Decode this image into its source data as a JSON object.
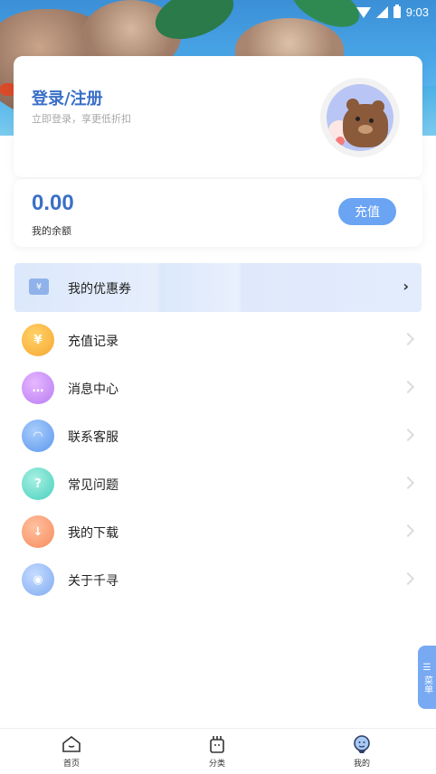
{
  "status_bar": {
    "time": "9:03"
  },
  "profile": {
    "title": "登录/注册",
    "subtitle": "立即登录，享更低折扣"
  },
  "balance": {
    "amount": "0.00",
    "label": "我的余额",
    "recharge_label": "充值"
  },
  "coupon": {
    "label": "我的优惠券",
    "icon": "coupon-icon",
    "chevron": "›"
  },
  "menu": [
    {
      "label": "充值记录",
      "icon": "money-bag-icon",
      "glyph": "¥",
      "color": "#f7a62f"
    },
    {
      "label": "消息中心",
      "icon": "message-icon",
      "glyph": "…",
      "color": "#b77bf2"
    },
    {
      "label": "联系客服",
      "icon": "headset-icon",
      "glyph": "◠",
      "color": "#5c97ee"
    },
    {
      "label": "常见问题",
      "icon": "question-icon",
      "glyph": "?",
      "color": "#47d0bd"
    },
    {
      "label": "我的下载",
      "icon": "cloud-download-icon",
      "glyph": "↓",
      "color": "#f78a5b"
    },
    {
      "label": "关于千寻",
      "icon": "eye-icon",
      "glyph": "◉",
      "color": "#7eaaf0"
    }
  ],
  "float_menu": {
    "label": "菜单"
  },
  "tabs": [
    {
      "label": "首页",
      "icon": "home-icon"
    },
    {
      "label": "分类",
      "icon": "category-icon"
    },
    {
      "label": "我的",
      "icon": "profile-icon"
    }
  ]
}
